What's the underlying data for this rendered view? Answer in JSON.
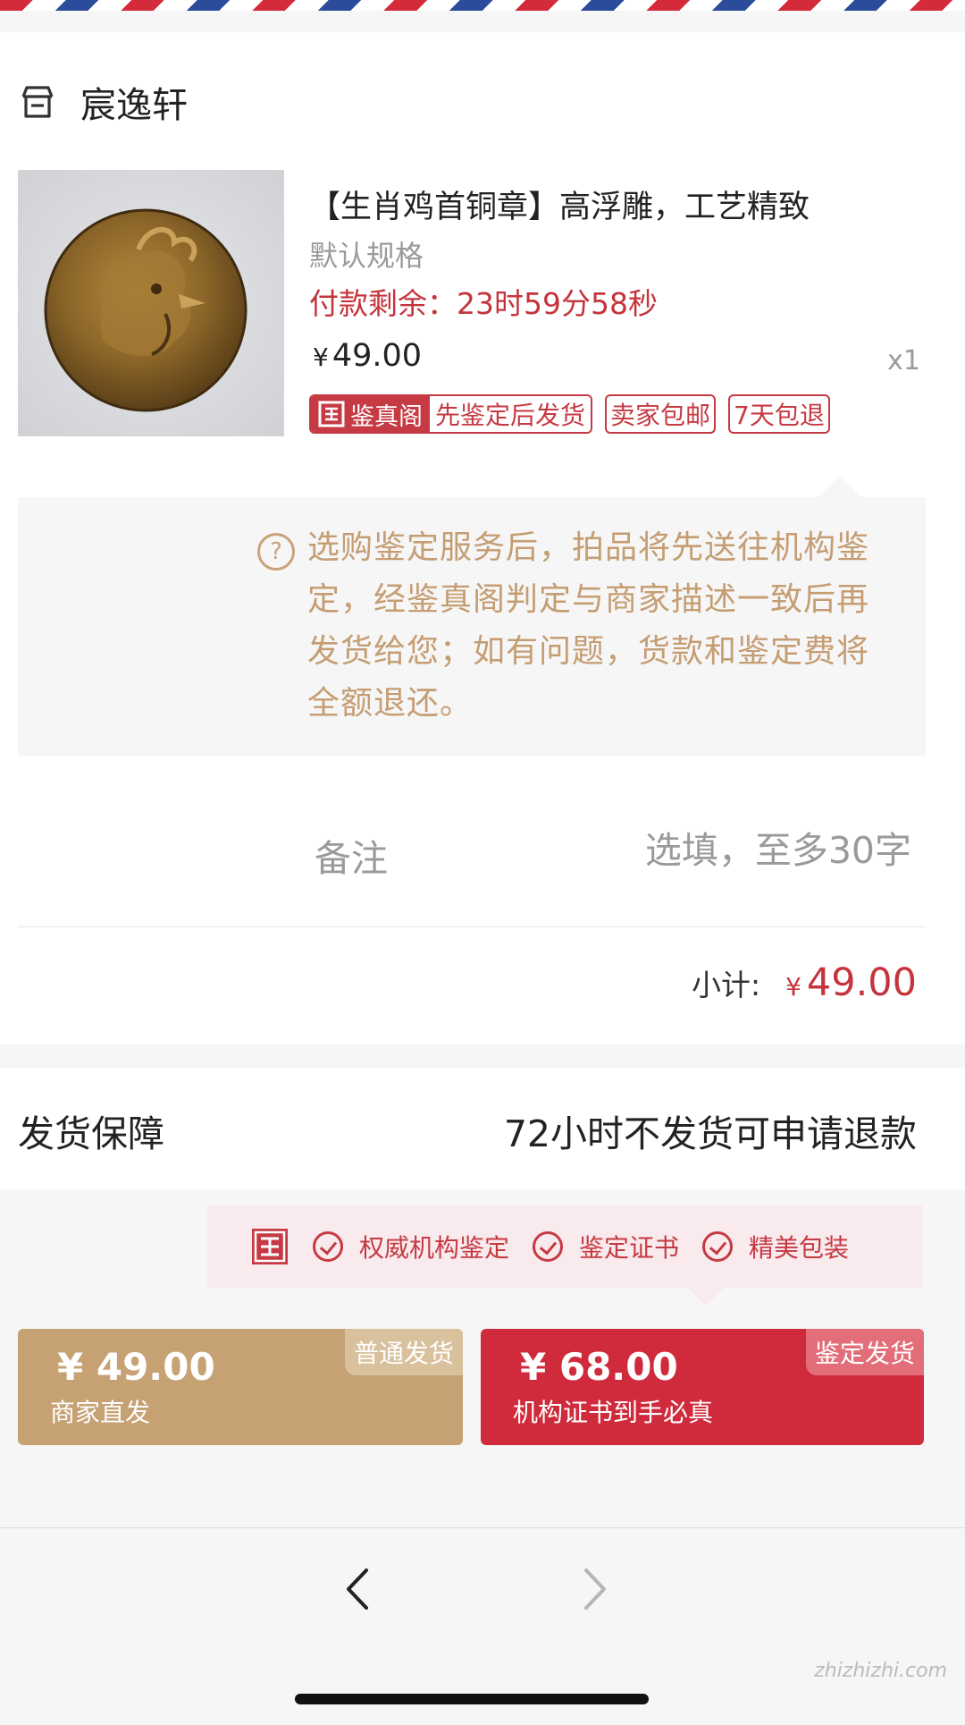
{
  "shop": {
    "name": "宸逸轩",
    "icon": "store-icon"
  },
  "product": {
    "title": "【生肖鸡首铜章】高浮雕，工艺精致",
    "spec": "默认规格",
    "countdown": "付款剩余：23时59分58秒",
    "currency": "¥",
    "price": "49.00",
    "quantity": "x1",
    "tag_brand": "鉴真阁",
    "tag_brand_text": "先鉴定后发货",
    "tag_free_ship": "卖家包邮",
    "tag_return": "7天包退"
  },
  "notice": {
    "text": "选购鉴定服务后，拍品将先送往机构鉴定，经鉴真阁判定与商家描述一致后再发货给您；如有问题，货款和鉴定费将全额退还。"
  },
  "remark": {
    "label": "备注",
    "placeholder": "选填，至多30字"
  },
  "subtotal": {
    "label": "小计:",
    "currency": "¥",
    "amount": "49.00"
  },
  "shipping": {
    "label": "发货保障",
    "value": "72小时不发货可申请退款"
  },
  "promo": {
    "items": [
      "权威机构鉴定",
      "鉴定证书",
      "精美包装"
    ]
  },
  "buttons": {
    "normal": {
      "price": "¥ 49.00",
      "sub": "商家直发",
      "corner": "普通发货"
    },
    "appraisal": {
      "price": "¥ 68.00",
      "sub": "机构证书到手必真",
      "corner": "鉴定发货"
    }
  },
  "watermark": "zhizhizhi.com",
  "colors": {
    "accent_red": "#c5343d",
    "gold": "#c6a173",
    "notice_text": "#c59d73"
  }
}
